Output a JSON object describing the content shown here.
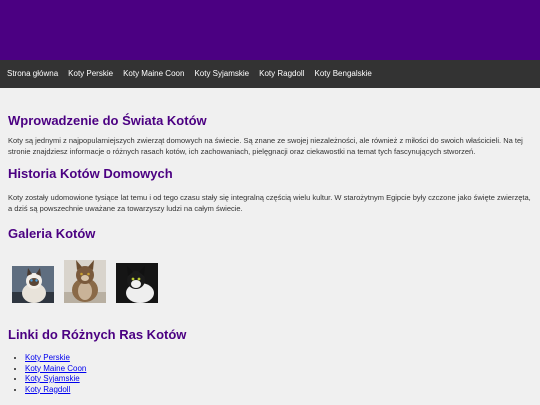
{
  "header": {
    "background": "#4b0082"
  },
  "nav": {
    "items": [
      {
        "label": "Strona główna"
      },
      {
        "label": "Koty Perskie"
      },
      {
        "label": "Koty Maine Coon"
      },
      {
        "label": "Koty Syjamskie"
      },
      {
        "label": "Koty Ragdoll"
      },
      {
        "label": "Koty Bengalskie"
      }
    ]
  },
  "sections": {
    "intro": {
      "title": "Wprowadzenie do Świata Kotów",
      "text": "Koty są jednymi z najpopularniejszych zwierząt domowych na świecie. Są znane ze swojej niezależności, ale również z miłości do swoich właścicieli. Na tej stronie znajdziesz informacje o różnych rasach kotów, ich zachowaniach, pielęgnacji oraz ciekawostki na temat tych fascynujących stworzeń."
    },
    "history": {
      "title": "Historia Kotów Domowych",
      "text": "Koty zostały udomowione tysiące lat temu i od tego czasu stały się integralną częścią wielu kultur. W starożytnym Egipcie były czczone jako święte zwierzęta, a dziś są powszechnie uważane za towarzyszy ludzi na całym świecie."
    },
    "gallery": {
      "title": "Galeria Kotów"
    },
    "links": {
      "title": "Linki do Różnych Ras Kotów",
      "items": [
        {
          "label": "Koty Perskie"
        },
        {
          "label": "Koty Maine Coon"
        },
        {
          "label": "Koty Syjamskie"
        },
        {
          "label": "Koty Ragdoll"
        }
      ]
    }
  },
  "colors": {
    "accent": "#4b0082",
    "nav_background": "#333333",
    "page_background": "#f0f0f0",
    "link": "#0000ee"
  }
}
